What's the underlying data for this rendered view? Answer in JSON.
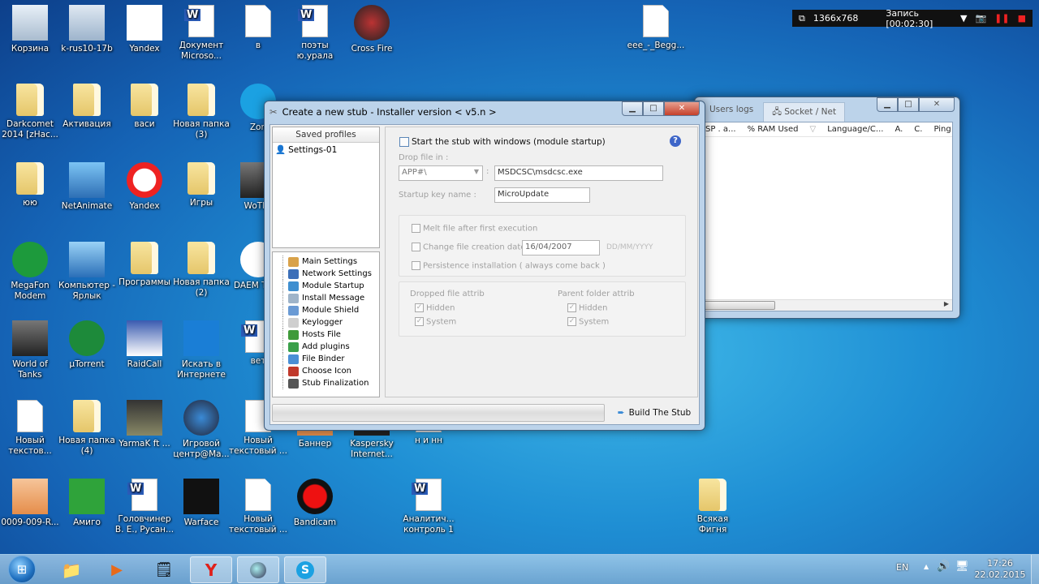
{
  "recorder": {
    "resolution": "1366x768",
    "status": "Запись [00:02:30]"
  },
  "desktop_icons": [
    {
      "label": "Корзина",
      "icon": "recycle-bin-icon"
    },
    {
      "label": "k-rus10-17b",
      "icon": "window-icon"
    },
    {
      "label": "Yandex",
      "icon": "yandex-icon"
    },
    {
      "label": "Документ Microso...",
      "icon": "word-doc-icon"
    },
    {
      "label": "в",
      "icon": "blank-file-icon"
    },
    {
      "label": "поэты ю.урала",
      "icon": "word-doc-icon"
    },
    {
      "label": "Cross Fire",
      "icon": "crossfire-icon"
    },
    {
      "label": "eee_-_Begg...",
      "icon": "mp3-file-icon"
    },
    {
      "label": "Darkcomet 2014 [zHac...",
      "icon": "folder-icon"
    },
    {
      "label": "Активация",
      "icon": "folder-icon"
    },
    {
      "label": "васи",
      "icon": "folder-icon"
    },
    {
      "label": "Новая папка (3)",
      "icon": "folder-icon"
    },
    {
      "label": "Zon",
      "icon": "zona-icon"
    },
    {
      "label": "юю",
      "icon": "folder-icon"
    },
    {
      "label": "NetAnimate",
      "icon": "network-icon"
    },
    {
      "label": "Yandex",
      "icon": "yandex-browser-icon"
    },
    {
      "label": "Игры",
      "icon": "folder-icon"
    },
    {
      "label": "WoTLa",
      "icon": "wot-icon"
    },
    {
      "label": "MegaFon Modem",
      "icon": "megafon-icon"
    },
    {
      "label": "Компьютер - Ярлык",
      "icon": "computer-icon"
    },
    {
      "label": "Программы",
      "icon": "folder-icon"
    },
    {
      "label": "Новая папка (2)",
      "icon": "folder-icon"
    },
    {
      "label": "DAEM Tools",
      "icon": "daemon-tools-icon"
    },
    {
      "label": "World of Tanks",
      "icon": "wot-icon"
    },
    {
      "label": "µTorrent",
      "icon": "utorrent-icon"
    },
    {
      "label": "RaidCall",
      "icon": "raidcall-icon"
    },
    {
      "label": "Искать в Интернете",
      "icon": "mail-search-icon"
    },
    {
      "label": "вет",
      "icon": "word-doc-icon"
    },
    {
      "label": "Новый текстов...",
      "icon": "text-file-icon"
    },
    {
      "label": "Новая папка (4)",
      "icon": "folder-icon"
    },
    {
      "label": "YarmaK ft ...",
      "icon": "video-icon"
    },
    {
      "label": "Игровой центр@Ма...",
      "icon": "game-center-icon"
    },
    {
      "label": "Новый текстовый ...",
      "icon": "text-file-icon"
    },
    {
      "label": "Баннер",
      "icon": "image-icon"
    },
    {
      "label": "Kaspersky Internet...",
      "icon": "kaspersky-icon"
    },
    {
      "label": "н и нн",
      "icon": "file-icon"
    },
    {
      "label": "0009-009-R...",
      "icon": "image-icon"
    },
    {
      "label": "Амиго",
      "icon": "amigo-icon"
    },
    {
      "label": "Головчинер В. Е., Русан...",
      "icon": "word-doc-icon"
    },
    {
      "label": "Warface",
      "icon": "warface-icon"
    },
    {
      "label": "Новый текстовый ...",
      "icon": "text-file-icon"
    },
    {
      "label": "Bandicam",
      "icon": "bandicam-icon"
    },
    {
      "label": "Аналитич... контроль 1",
      "icon": "word-doc-icon"
    },
    {
      "label": "Всякая Фигня",
      "icon": "folder-icon"
    }
  ],
  "bg_window": {
    "tabs": [
      "Users logs",
      "Socket / Net"
    ],
    "columns": [
      "SP . a...",
      "% RAM Used",
      "Language/C...",
      "A.",
      "C.",
      "Ping"
    ]
  },
  "dialog": {
    "title": "Create a new stub - Installer version < v5.n >",
    "saved_profiles_header": "Saved profiles",
    "profiles": [
      "Settings-01"
    ],
    "tree": [
      {
        "label": "Main Settings",
        "color": "#d9a24a"
      },
      {
        "label": "Network Settings",
        "color": "#3c6fb8"
      },
      {
        "label": "Module Startup",
        "color": "#3f8fd0"
      },
      {
        "label": "Install Message",
        "color": "#9fb4c9"
      },
      {
        "label": "Module Shield",
        "color": "#6a9ad4"
      },
      {
        "label": "Keylogger",
        "color": "#cfcfcf"
      },
      {
        "label": "Hosts File",
        "color": "#3f9a3a"
      },
      {
        "label": "Add plugins",
        "color": "#3aa04a"
      },
      {
        "label": "File Binder",
        "color": "#4a8fd6"
      },
      {
        "label": "Choose Icon",
        "color": "#c0392b"
      },
      {
        "label": "Stub Finalization",
        "color": "#555555"
      }
    ],
    "start_with_windows": "Start the stub with windows (module startup)",
    "drop_file_in_label": "Drop file in :",
    "drop_location": "APP#\\",
    "path_separator": ":",
    "drop_path": "MSDCSC\\msdcsc.exe",
    "startup_key_label": "Startup key name :",
    "startup_key_value": "MicroUpdate",
    "melt_label": "Melt file after first execution",
    "change_date_label": "Change file creation date :",
    "date_value": "16/04/2007",
    "date_format": "DD/MM/YYYY",
    "persistence_label": "Persistence installation ( always come back )",
    "dropped_attrib_title": "Dropped file attrib",
    "parent_attrib_title": "Parent folder attrib",
    "attrib_hidden": "Hidden",
    "attrib_system": "System",
    "check_mark": "✓",
    "help_glyph": "?",
    "build_button": "Build The Stub",
    "progress": 0
  },
  "taskbar": {
    "lang": "EN",
    "time": "17:26",
    "date": "22.02.2015"
  }
}
